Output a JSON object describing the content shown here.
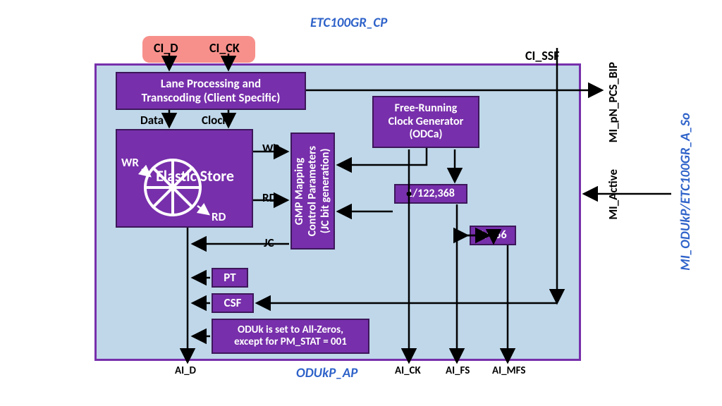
{
  "top_label": "ETC100GR_CP",
  "bottom_label": "ODUkP_AP",
  "right_label": "MI_ODUkP/ETC100GR_A_So",
  "ci": {
    "d": "CI_D",
    "ck": "CI_CK",
    "ssf": "CI_SSF"
  },
  "ai": {
    "d": "AI_D",
    "ck": "AI_CK",
    "fs": "AI_FS",
    "mfs": "AI_MFS"
  },
  "mi": {
    "pn_pcs_bip": "MI_pN_PCS_BIP",
    "active": "MI_Active"
  },
  "blocks": {
    "lane": "Lane Processing and\nTranscoding (Client Specific)",
    "elastic": "Elastic Store",
    "gmp": "GMP Mapping\nControl Parameters\n(JC bit generation)",
    "clock": "Free-Running\nClock Generator\n(ODCa)",
    "div1": "1/122,368",
    "div2": "1/256",
    "pt": "PT",
    "csf": "CSF",
    "oduk": "ODUk is set to All-Zeros,\nexcept for PM_STAT = 001"
  },
  "pins": {
    "data": "Data",
    "clock": "Clock",
    "wr": "WR",
    "rd": "RD",
    "jc": "JC"
  },
  "es": {
    "wr": "WR",
    "rd": "RD"
  }
}
